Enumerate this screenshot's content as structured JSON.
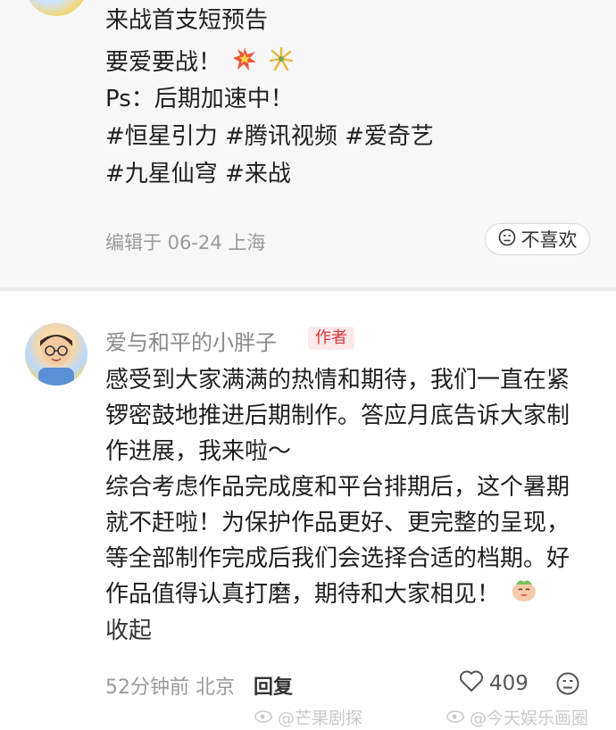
{
  "post": {
    "lines": [
      "来战首支短预告",
      "要爱要战！",
      "Ps：后期加速中！",
      "#恒星引力 #腾讯视频 #爱奇艺",
      "#九星仙穹 #来战"
    ],
    "meta": "编辑于 06-24 上海",
    "dislike_label": "不喜欢"
  },
  "comment": {
    "username": "爱与和平的小胖子",
    "badge": "作者",
    "paragraphs": [
      "感受到大家满满的热情和期待，我们一直在紧",
      "锣密鼓地推进后期制作。答应月底告诉大家制",
      "作进展，我来啦～",
      "综合考虑作品完成度和平台排期后，这个暑期",
      "就不赶啦！为保护作品更好、更完整的呈现，",
      "等全部制作完成后我们会选择合适的档期。好",
      "作品值得认真打磨，期待和大家相见！"
    ],
    "collapse_label": "收起",
    "time": "52分钟前",
    "location": "北京",
    "reply_label": "回复",
    "like_count": "409"
  },
  "watermarks": [
    "@芒果剧探",
    "@今天娱乐画圈"
  ],
  "colors": {
    "badge_bg": "#fde9ea",
    "badge_text": "#d9363e"
  }
}
